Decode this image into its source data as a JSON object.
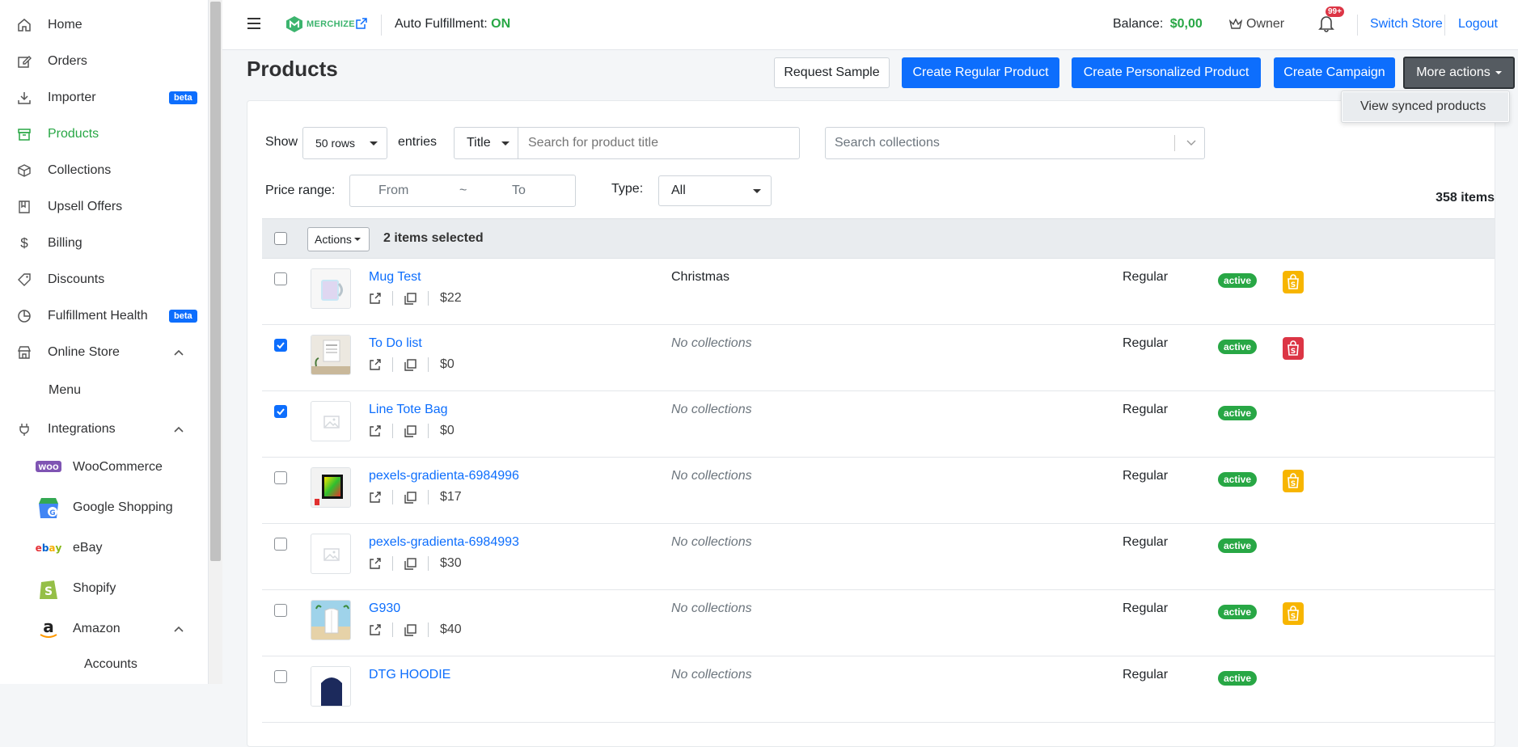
{
  "sidebar": {
    "items": [
      {
        "label": "Home",
        "icon": "home-icon"
      },
      {
        "label": "Orders",
        "icon": "edit-icon"
      },
      {
        "label": "Importer",
        "icon": "download-icon",
        "badge": "beta"
      },
      {
        "label": "Products",
        "icon": "archive-icon"
      },
      {
        "label": "Collections",
        "icon": "cube-icon"
      },
      {
        "label": "Upsell Offers",
        "icon": "book-icon"
      },
      {
        "label": "Billing",
        "icon": "dollar-icon"
      },
      {
        "label": "Discounts",
        "icon": "tag-icon"
      },
      {
        "label": "Fulfillment Health",
        "icon": "pie-chart-icon",
        "badge": "beta"
      },
      {
        "label": "Online Store",
        "icon": "store-icon"
      }
    ],
    "online_store_sub": "Menu",
    "integrations_label": "Integrations",
    "integrations": [
      {
        "label": "WooCommerce",
        "logo": "WOO"
      },
      {
        "label": "Google Shopping",
        "logo": "G"
      },
      {
        "label": "eBay",
        "logo": "ebay"
      },
      {
        "label": "Shopify",
        "logo": "S"
      },
      {
        "label": "Amazon",
        "logo": "a"
      }
    ],
    "amazon_sub": "Accounts"
  },
  "topbar": {
    "logo_text": "MERCHIZE",
    "auto_label": "Auto Fulfillment:",
    "auto_value": "ON",
    "balance_label": "Balance:",
    "balance_value": "$0,00",
    "role": "Owner",
    "notif_count": "99+",
    "switch_store": "Switch Store",
    "logout": "Logout"
  },
  "page": {
    "title": "Products",
    "buttons": {
      "request_sample": "Request Sample",
      "create_regular": "Create Regular Product",
      "create_personalized": "Create Personalized Product",
      "create_campaign": "Create Campaign",
      "more_actions": "More actions"
    },
    "dropdown_item": "View synced products"
  },
  "filters": {
    "show_label": "Show",
    "rows_value": "50 rows",
    "entries_label": "entries",
    "search_field": "Title",
    "search_placeholder": "Search for product title",
    "collections_placeholder": "Search collections",
    "price_label": "Price range:",
    "price_from": "From",
    "price_tilde": "~",
    "price_to": "To",
    "type_label": "Type:",
    "type_value": "All",
    "total": "358 items"
  },
  "table": {
    "actions_label": "Actions",
    "selected_label": "2 items selected",
    "rows": [
      {
        "name": "Mug Test",
        "price": "$22",
        "collection": "Christmas",
        "type": "Regular",
        "status": "active",
        "checked": false,
        "shop": "gold"
      },
      {
        "name": "To Do list",
        "price": "$0",
        "collection": "No collections",
        "type": "Regular",
        "status": "active",
        "checked": true,
        "shop": "red"
      },
      {
        "name": "Line Tote Bag",
        "price": "$0",
        "collection": "No collections",
        "type": "Regular",
        "status": "active",
        "checked": true,
        "shop": ""
      },
      {
        "name": "pexels-gradienta-6984996",
        "price": "$17",
        "collection": "No collections",
        "type": "Regular",
        "status": "active",
        "checked": false,
        "shop": "gold"
      },
      {
        "name": "pexels-gradienta-6984993",
        "price": "$30",
        "collection": "No collections",
        "type": "Regular",
        "status": "active",
        "checked": false,
        "shop": ""
      },
      {
        "name": "G930",
        "price": "$40",
        "collection": "No collections",
        "type": "Regular",
        "status": "active",
        "checked": false,
        "shop": "gold"
      },
      {
        "name": "DTG HOODIE",
        "price": "",
        "collection": "No collections",
        "type": "Regular",
        "status": "active",
        "checked": false,
        "shop": ""
      }
    ]
  },
  "colors": {
    "primary": "#0d6efd",
    "success": "#28a745",
    "shop_gold": "#f7b500",
    "shop_red": "#dc3545"
  }
}
